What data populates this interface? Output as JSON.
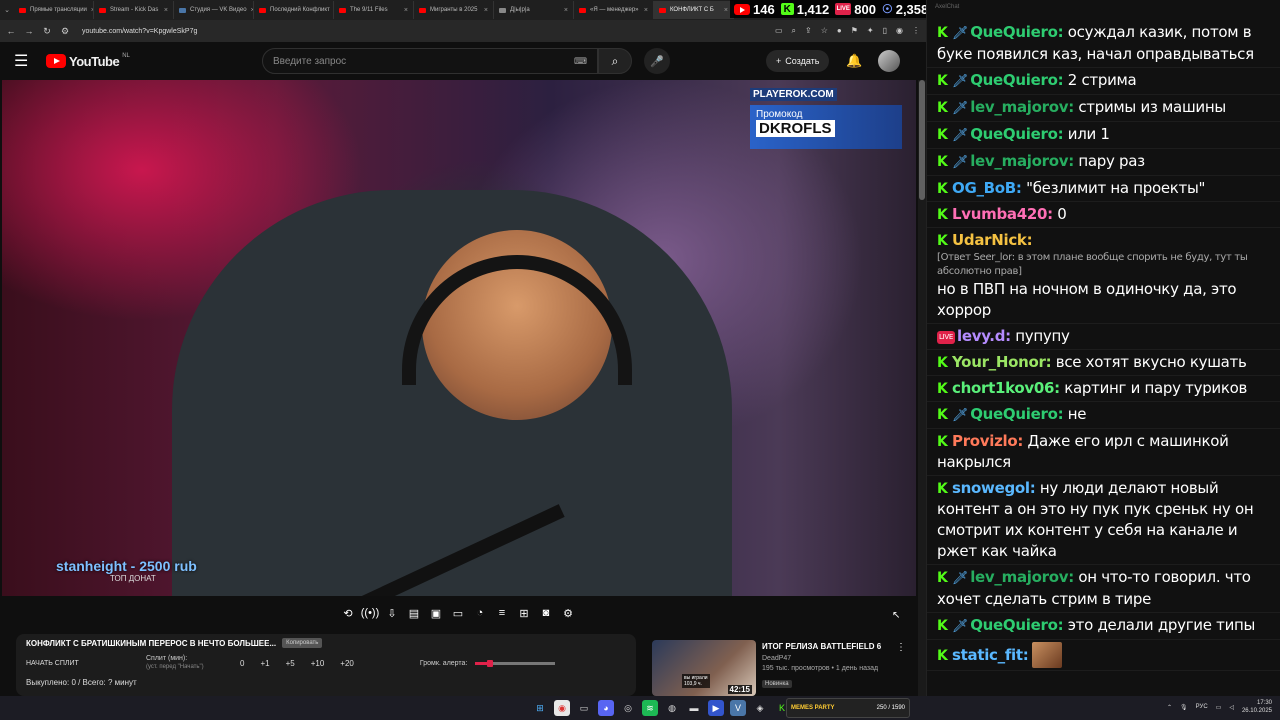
{
  "browser": {
    "tabs": [
      {
        "label": "Прямые трансляции",
        "icon": "youtube"
      },
      {
        "label": "Stream - Kick Das",
        "icon": "youtube"
      },
      {
        "label": "Студия — VK Видео",
        "icon": "vk"
      },
      {
        "label": "Последний Конфликт",
        "icon": "youtube"
      },
      {
        "label": "The 9/11 Files",
        "icon": "youtube"
      },
      {
        "label": "Мигранты в 2025",
        "icon": "youtube"
      },
      {
        "label": "Д|ы|р|а",
        "icon": "gray"
      },
      {
        "label": "«Я — менеджер»",
        "icon": "youtube"
      },
      {
        "label": "КОНФЛИКТ С Б",
        "icon": "youtube",
        "active": true
      }
    ],
    "url": "youtube.com/watch?v=KpgwleSkP7g"
  },
  "stream_stats": {
    "youtube": "146",
    "kick": "1,412",
    "vk": "800",
    "twitch": "2,358"
  },
  "youtube": {
    "logo_text": "YouTube",
    "logo_region": "NL",
    "search_placeholder": "Введите запрос",
    "create_label": "Создать"
  },
  "video": {
    "promo_site": "PLAYEROK.COM",
    "promo_label": "Промокод",
    "promo_code": "DKROFLS",
    "donat_name": "stanheight - 2500 rub",
    "donat_sub": "ТОП ДОНАТ"
  },
  "panel": {
    "title": "КОНФЛИКТ С БРАТИШКИНЫМ ПЕРЕРОС В НЕЧТО БОЛЬШЕЕ...",
    "copy_label": "Копировать",
    "split_button": "НАЧАТЬ СПЛИТ",
    "split_label": "Сплит (мин):",
    "split_hint": "(уст. перед \"Начать\")",
    "split_values": [
      "0",
      "+1",
      "+5",
      "+10",
      "+20"
    ],
    "alert_label": "Громк. алерта:",
    "alert_volume_fraction": 0.18,
    "bought": "Выкуплено: 0 / Всего: ? минут"
  },
  "recommended": {
    "title": "ИТОГ РЕЛИЗА BATTLEFIELD 6",
    "channel": "DeadP47",
    "meta": "195 тыс. просмотров • 1 день назад",
    "badge": "Новинка",
    "duration": "42:15",
    "thumb_tag1": "вы играли",
    "thumb_tag2": "103,9 ч."
  },
  "taskbar": {
    "memes_title": "MEMES PARTY",
    "memes_count": "250 / 1590",
    "lang": "РУС",
    "time": "17:30",
    "date": "26.10.2025"
  },
  "chat": {
    "header": "AxelChat",
    "messages": [
      {
        "platform": "kick",
        "mod": true,
        "user": "QueQuiero",
        "color": "#2ecc71",
        "text": "осуждал казик, потом в буке появился каз, начал оправдываться"
      },
      {
        "platform": "kick",
        "mod": true,
        "user": "QueQuiero",
        "color": "#2ecc71",
        "text": "2 стрима"
      },
      {
        "platform": "kick",
        "mod": true,
        "user": "lev_majorov",
        "color": "#27ae60",
        "text": "стримы из машины"
      },
      {
        "platform": "kick",
        "mod": true,
        "user": "QueQuiero",
        "color": "#2ecc71",
        "text": "или 1"
      },
      {
        "platform": "kick",
        "mod": true,
        "user": "lev_majorov",
        "color": "#27ae60",
        "text": "пару раз"
      },
      {
        "platform": "kick",
        "mod": false,
        "user": "OG_BoB",
        "color": "#3fa9f5",
        "text": "\"безлимит на проекты\""
      },
      {
        "platform": "kick",
        "mod": false,
        "user": "Lvumba420",
        "color": "#ff6fb5",
        "text": "0"
      },
      {
        "platform": "kick",
        "mod": false,
        "user": "UdarNick",
        "color": "#f5c242",
        "text": "",
        "reply": "[Ответ Seer_lor: в этом плане вообще спорить не буду, тут ты абсолютно прав]",
        "text2": "но в ПВП на ночном в одиночку да, это хоррор"
      },
      {
        "platform": "vk",
        "mod": false,
        "user": "levy.d",
        "color": "#b58cff",
        "text": "пупупу"
      },
      {
        "platform": "kick",
        "mod": false,
        "user": "Your_Honor",
        "color": "#9be564",
        "text": "все хотят вкусно кушать"
      },
      {
        "platform": "kick",
        "mod": false,
        "user": "chort1kov06",
        "color": "#5af07a",
        "text": "картинг и пару туриков"
      },
      {
        "platform": "kick",
        "mod": true,
        "user": "QueQuiero",
        "color": "#2ecc71",
        "text": "не"
      },
      {
        "platform": "kick",
        "mod": false,
        "user": "Provizlo",
        "color": "#ff7a5a",
        "text": "Даже его ирл с машинкой накрылся"
      },
      {
        "platform": "kick",
        "mod": false,
        "user": "snowegol",
        "color": "#5ab8ff",
        "text": "ну люди делают новый контент а он это ну пук пук среньк ну он смотрит их контент у себя на канале и ржет как чайка"
      },
      {
        "platform": "kick",
        "mod": true,
        "user": "lev_majorov",
        "color": "#27ae60",
        "text": "он что-то говорил. что хочет сделать стрим в тире"
      },
      {
        "platform": "kick",
        "mod": true,
        "user": "QueQuiero",
        "color": "#2ecc71",
        "text": "это делали другие типы"
      },
      {
        "platform": "kick",
        "mod": false,
        "user": "static_fit",
        "color": "#5ab8ff",
        "text": "",
        "emote": true
      }
    ]
  }
}
